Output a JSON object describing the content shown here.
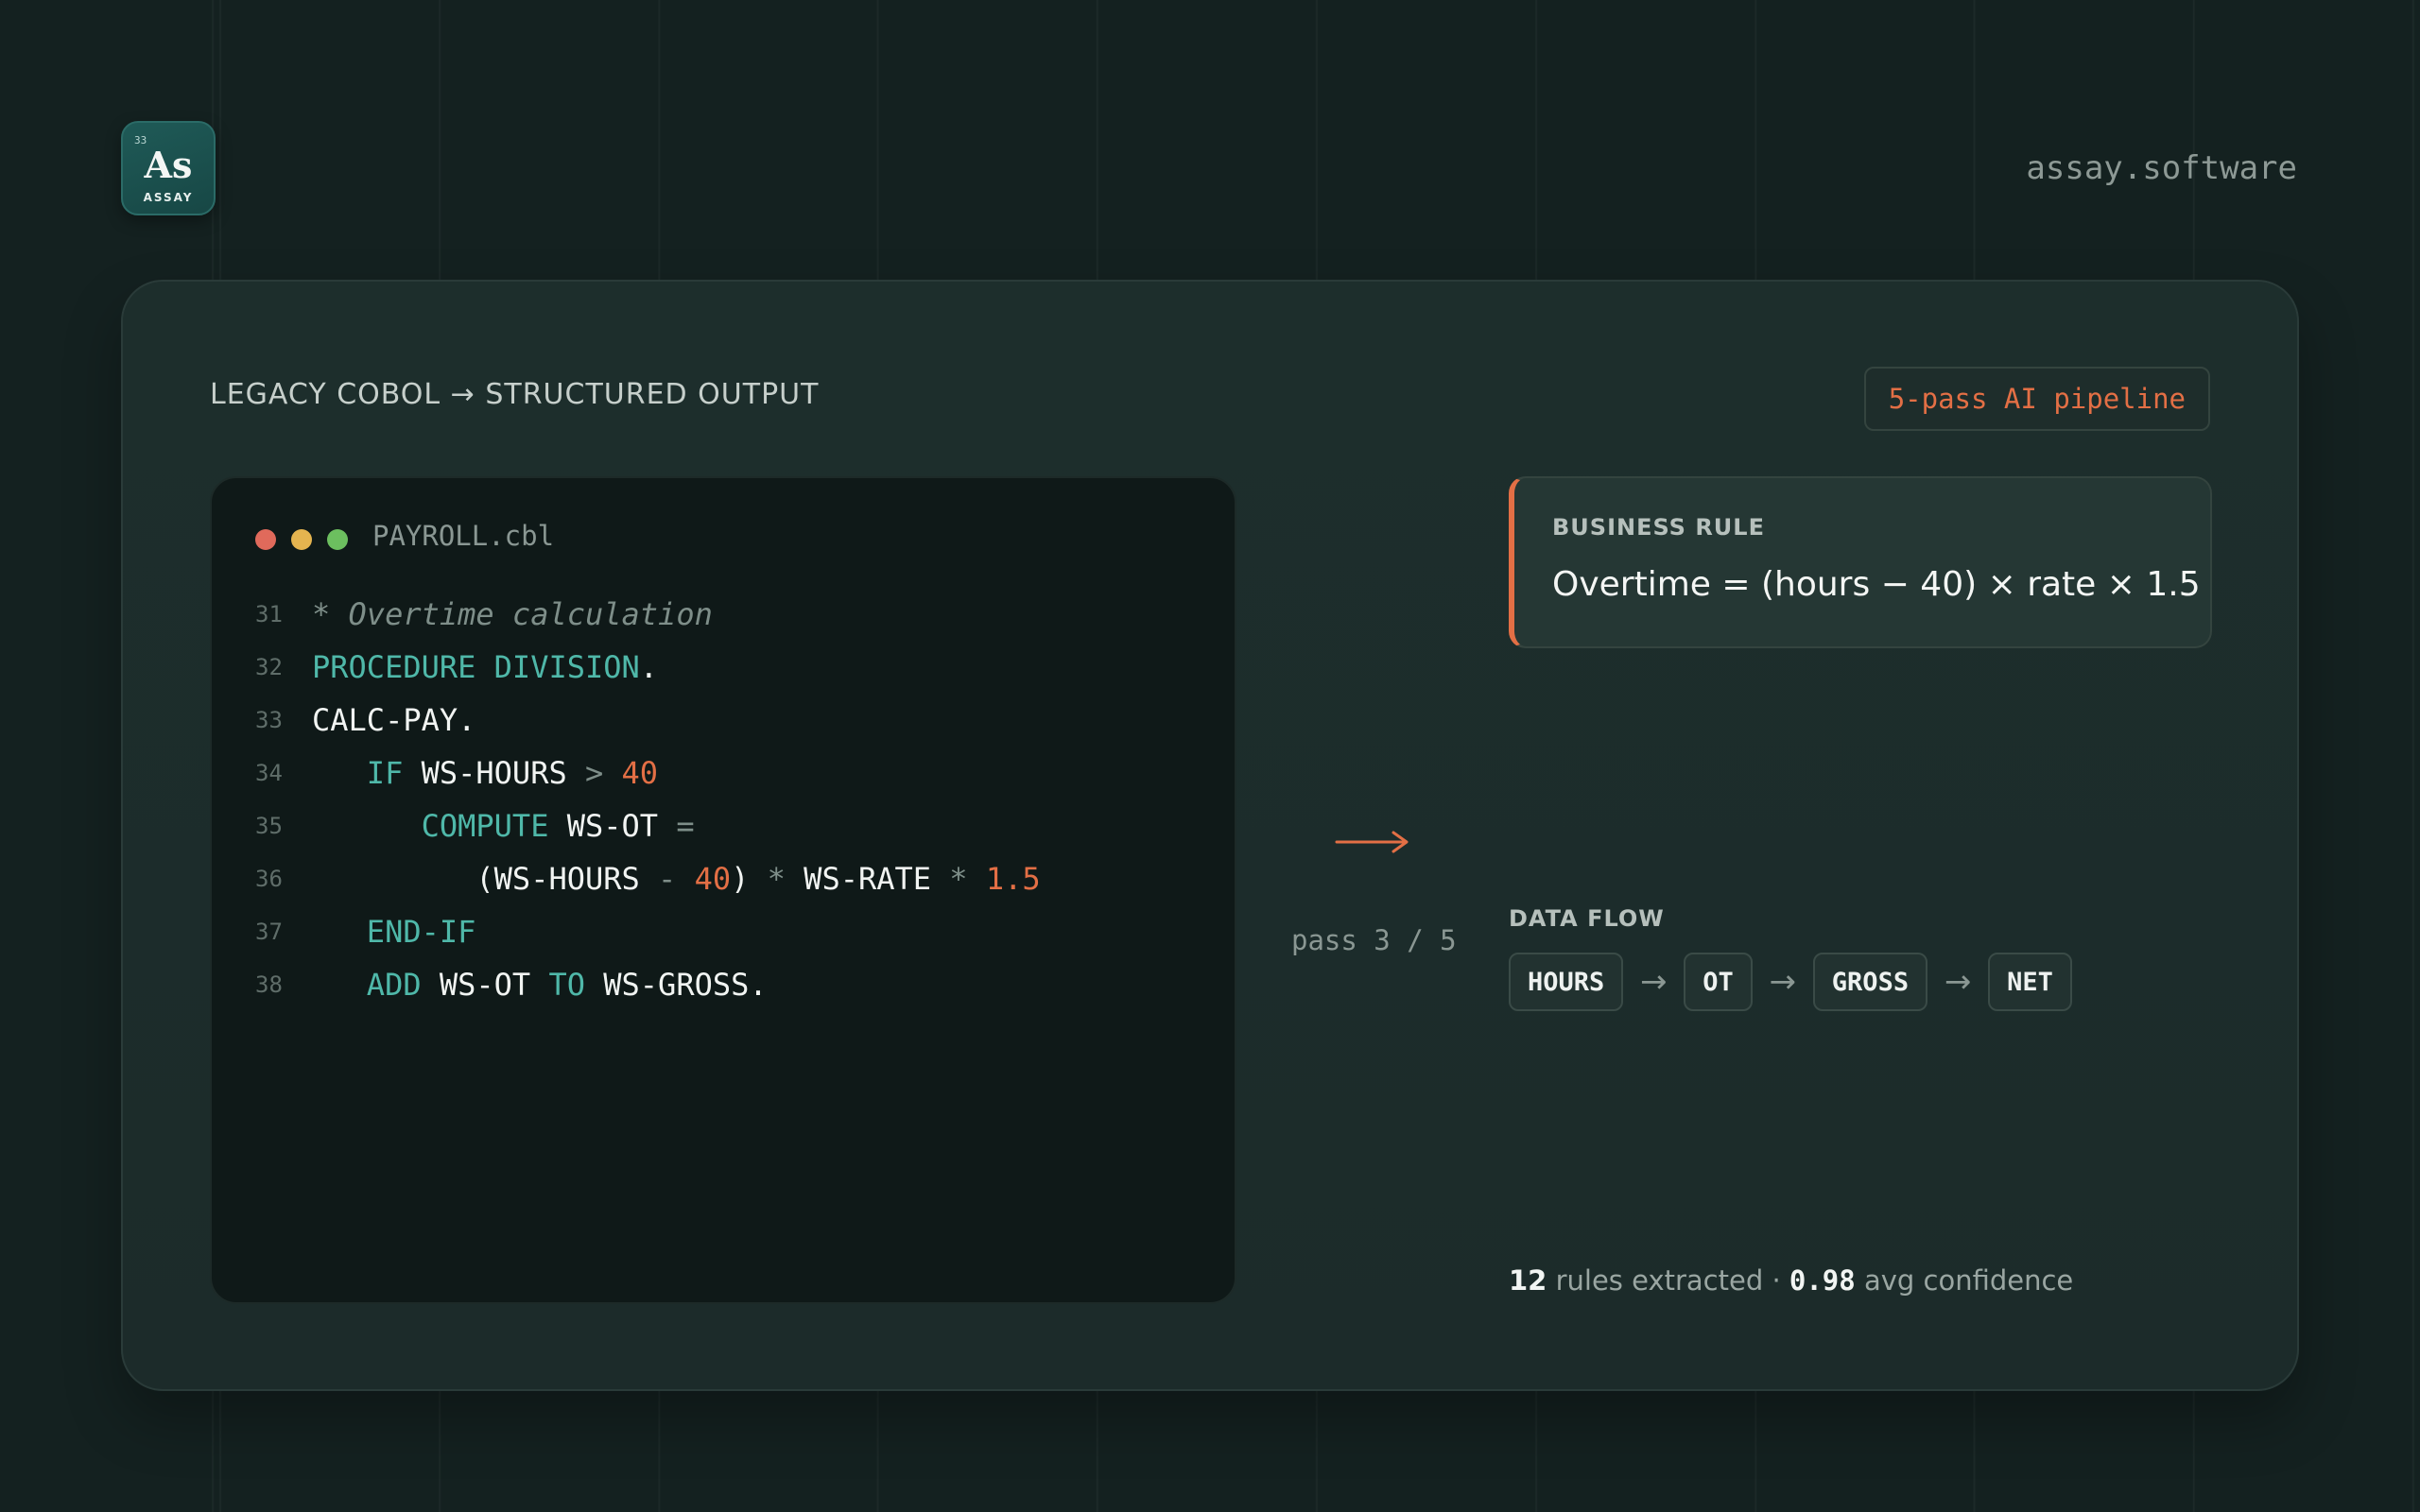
{
  "brand": {
    "logo_number": "33",
    "logo_mark": "As",
    "logo_name": "ASSAY",
    "domain": "assay.software"
  },
  "card": {
    "title": "LEGACY COBOL → STRUCTURED OUTPUT",
    "badge": "5-pass AI pipeline"
  },
  "code": {
    "filename": "PAYROLL.cbl",
    "lines": [
      {
        "num": "31",
        "tokens": [
          {
            "t": "* Overtime calculation",
            "c": "comment"
          }
        ]
      },
      {
        "num": "32",
        "tokens": [
          {
            "t": "PROCEDURE DIVISION",
            "c": "kw"
          },
          {
            "t": ".",
            "c": "id"
          }
        ]
      },
      {
        "num": "33",
        "tokens": [
          {
            "t": "CALC-PAY.",
            "c": "id"
          }
        ]
      },
      {
        "num": "34",
        "tokens": [
          {
            "t": "   ",
            "c": "id"
          },
          {
            "t": "IF",
            "c": "kw"
          },
          {
            "t": " WS-HOURS ",
            "c": "id"
          },
          {
            "t": ">",
            "c": "op"
          },
          {
            "t": " ",
            "c": "id"
          },
          {
            "t": "40",
            "c": "num"
          }
        ]
      },
      {
        "num": "35",
        "tokens": [
          {
            "t": "      ",
            "c": "id"
          },
          {
            "t": "COMPUTE",
            "c": "kw"
          },
          {
            "t": " WS-OT ",
            "c": "id"
          },
          {
            "t": "=",
            "c": "op"
          }
        ]
      },
      {
        "num": "36",
        "tokens": [
          {
            "t": "         (WS-HOURS ",
            "c": "id"
          },
          {
            "t": "-",
            "c": "op"
          },
          {
            "t": " ",
            "c": "id"
          },
          {
            "t": "40",
            "c": "num"
          },
          {
            "t": ") ",
            "c": "id"
          },
          {
            "t": "*",
            "c": "op"
          },
          {
            "t": " WS-RATE ",
            "c": "id"
          },
          {
            "t": "*",
            "c": "op"
          },
          {
            "t": " ",
            "c": "id"
          },
          {
            "t": "1.5",
            "c": "num"
          }
        ]
      },
      {
        "num": "37",
        "tokens": [
          {
            "t": "   ",
            "c": "id"
          },
          {
            "t": "END-IF",
            "c": "kw"
          }
        ]
      },
      {
        "num": "38",
        "tokens": [
          {
            "t": "   ",
            "c": "id"
          },
          {
            "t": "ADD",
            "c": "kw"
          },
          {
            "t": " WS-OT ",
            "c": "id"
          },
          {
            "t": "TO",
            "c": "kw"
          },
          {
            "t": " WS-GROSS.",
            "c": "id"
          }
        ]
      }
    ]
  },
  "pipeline": {
    "pass_label": "pass 3 / 5"
  },
  "business_rule": {
    "label": "BUSINESS RULE",
    "text": "Overtime = (hours − 40) × rate × 1.5"
  },
  "data_flow": {
    "label": "DATA FLOW",
    "nodes": [
      "HOURS",
      "OT",
      "GROSS",
      "NET"
    ],
    "arrow": "→"
  },
  "stats": {
    "rules_count": "12",
    "rules_text": "rules extracted ·",
    "confidence": "0.98",
    "confidence_text": "avg confidence"
  },
  "colors": {
    "accent": "#e36f45",
    "keyword": "#4fb8a9",
    "background": "#142120"
  }
}
